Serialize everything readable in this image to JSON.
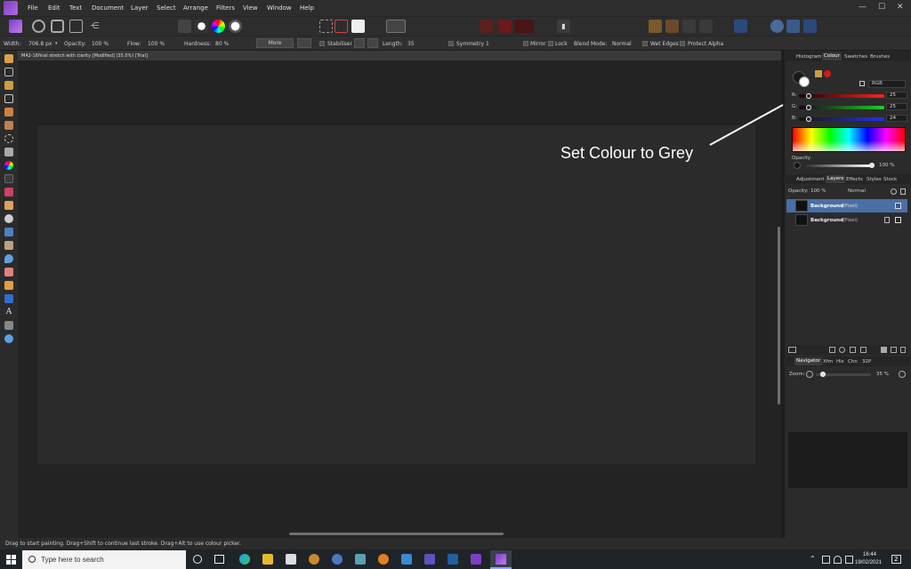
{
  "menu": {
    "items": [
      "File",
      "Edit",
      "Text",
      "Document",
      "Layer",
      "Select",
      "Arrange",
      "Filters",
      "View",
      "Window",
      "Help"
    ]
  },
  "window_controls": {
    "minimize": "—",
    "maximize": "☐",
    "close": "✕"
  },
  "context_toolbar": {
    "width_label": "Width:",
    "width_value": "706.8 px",
    "opacity_label": "Opacity:",
    "opacity_value": "100 %",
    "flow_label": "Flow:",
    "flow_value": "100 %",
    "hardness_label": "Hardness:",
    "hardness_value": "80 %",
    "more_label": "More",
    "stabiliser_label": "Stabiliser",
    "length_label": "Length:",
    "length_value": "35",
    "symmetry_label": "Symmetry",
    "symmetry_value": "1",
    "mirror_label": "Mirror",
    "lock_label": "Lock",
    "blend_label": "Blend Mode:",
    "blend_value": "Normal",
    "wet_edges_label": "Wet Edges",
    "protect_alpha_label": "Protect Alpha"
  },
  "document": {
    "tab_title": "M42-16final stretch with clarity [Modified] (35.0%) [Trial]"
  },
  "annotation": {
    "text": "Set Colour to Grey"
  },
  "colour_panel": {
    "tabs": [
      "Histogram",
      "Colour",
      "Swatches",
      "Brushes"
    ],
    "active_tab": "Colour",
    "model": "RGB",
    "channels": [
      {
        "label": "R:",
        "value": "25",
        "color": "#e02020"
      },
      {
        "label": "G:",
        "value": "25",
        "color": "#20c020"
      },
      {
        "label": "B:",
        "value": "24",
        "color": "#2030e0"
      }
    ],
    "opacity_label": "Opacity",
    "opacity_value": "100 %"
  },
  "layers_panel": {
    "tabs": [
      "Adjustment",
      "Layers",
      "Effects",
      "Styles",
      "Stock"
    ],
    "active_tab": "Layers",
    "opacity_label": "Opacity:",
    "opacity_value": "100 %",
    "blend_value": "Normal",
    "layers": [
      {
        "name": "Background",
        "type": "(Pixel)",
        "selected": true
      },
      {
        "name": "Background",
        "type": "(Pixel)",
        "selected": false
      }
    ]
  },
  "navigator_panel": {
    "tabs": [
      "Navigator",
      "Xfm",
      "His",
      "Chn",
      "32P"
    ],
    "active_tab": "Navigator",
    "zoom_label": "Zoom:",
    "zoom_value": "35 %"
  },
  "status_bar": {
    "text": "Drag to start painting. Drag+Shift to continue last stroke. Drag+Alt to use colour picker."
  },
  "taskbar": {
    "search_placeholder": "Type here to search",
    "time": "16:44",
    "date": "19/02/2021",
    "notification_count": "2"
  },
  "colors": {
    "accent": "#7b3fc4",
    "selected_layer": "#4a6fa5"
  }
}
